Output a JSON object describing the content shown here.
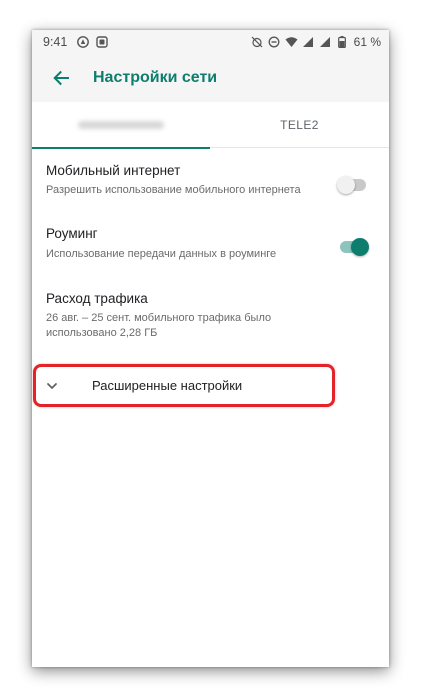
{
  "status_bar": {
    "time": "9:41",
    "battery_percent": "61 %",
    "icons_left": [
      "status-notification-icon",
      "status-photo-icon"
    ],
    "icons_right": [
      "alarm-off-icon",
      "dnd-icon",
      "wifi-icon",
      "signal-icon",
      "signal-icon",
      "battery-icon"
    ]
  },
  "app_bar": {
    "title": "Настройки сети",
    "back_icon": "arrow-back-icon"
  },
  "tabs": [
    {
      "label": "",
      "selected": true,
      "obscured": true
    },
    {
      "label": "TELE2",
      "selected": false
    }
  ],
  "settings": {
    "mobile_internet": {
      "title": "Мобильный интернет",
      "subtitle": "Разрешить использование мобильного интернета",
      "enabled": false
    },
    "roaming": {
      "title": "Роуминг",
      "subtitle": "Использование передачи данных в роуминге",
      "enabled": true
    },
    "data_usage": {
      "title": "Расход трафика",
      "subtitle": "26 авг. – 25 сент. мобильного трафика было использовано 2,28 ГБ"
    },
    "advanced": {
      "label": "Расширенные настройки",
      "icon": "chevron-down-icon"
    }
  },
  "colors": {
    "accent": "#0d7d6e",
    "highlight": "#e3232a",
    "bar_background": "#f5f5f5"
  }
}
